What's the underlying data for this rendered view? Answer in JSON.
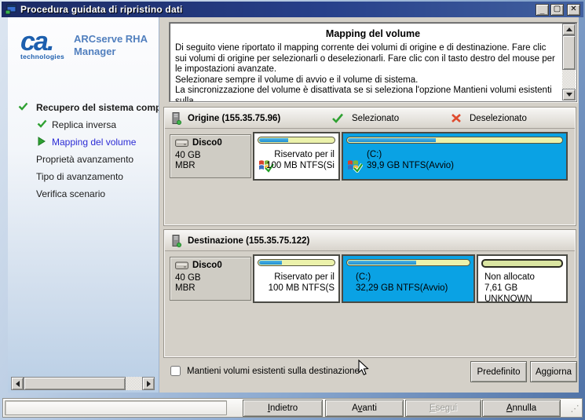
{
  "window": {
    "title": "Procedura guidata di ripristino dati",
    "minimize": "_",
    "maximize": "▢",
    "close": "✕"
  },
  "colors": {
    "titlebar": "#1B2A64",
    "selected_volume": "#0AA2E4",
    "bar_used": "#1F8FD0",
    "bar_free": "#ECF2AB",
    "step_current_text": "#2B2BD5",
    "check_green": "#2FA132",
    "cross_red": "#DF4B2E"
  },
  "sidebar": {
    "brand": "ca.",
    "brand_sub": "technologies",
    "product_line1": "ARCserve RHA",
    "product_line2": "Manager",
    "steps": [
      {
        "label": "Recupero del sistema completo",
        "state": "done"
      },
      {
        "label": "Replica inversa",
        "state": "done"
      },
      {
        "label": "Mapping del volume",
        "state": "current"
      },
      {
        "label": "Proprietà avanzamento",
        "state": "pending"
      },
      {
        "label": "Tipo di avanzamento",
        "state": "pending"
      },
      {
        "label": "Verifica scenario",
        "state": "pending"
      }
    ]
  },
  "description": {
    "title": "Mapping del volume",
    "body": "Di seguito viene riportato il mapping corrente dei volumi di origine e di destinazione. Fare clic sui volumi di origine per selezionarli o deselezionarli. Fare clic con il tasto destro del mouse per le impostazioni avanzate.\nSelezionare sempre il volume di avvio e il volume di sistema.\nLa sincronizzazione del volume è disattivata se si seleziona l'opzione Mantieni volumi esistenti sulla"
  },
  "origin": {
    "title": "Origine (155.35.75.96)",
    "legend_selected": "Selezionato",
    "legend_deselected": "Deselezionato",
    "disk": {
      "name": "Disco0",
      "size": "40 GB",
      "partition": "MBR"
    },
    "volumes": [
      {
        "line1": "Riservato per il",
        "line2": "100 MB NTFS(Si",
        "used_pct": 38,
        "selected": false
      },
      {
        "line1": "(C:)",
        "line2": "39,9 GB NTFS(Avvio)",
        "used_pct": 41,
        "selected": true
      }
    ]
  },
  "destination": {
    "title": "Destinazione (155.35.75.122)",
    "disk": {
      "name": "Disco0",
      "size": "40 GB",
      "partition": "MBR"
    },
    "volumes": [
      {
        "line1": "Riservato per il",
        "line2": "100 MB NTFS(S",
        "used_pct": 30,
        "selected": false
      },
      {
        "line1": "(C:)",
        "line2": "32,29 GB NTFS(Avvio)",
        "used_pct": 56,
        "selected": true
      },
      {
        "line1": "Non allocato",
        "line2": "7,61 GB UNKNOWN",
        "used_pct": 0,
        "selected": false,
        "unallocated": true
      }
    ]
  },
  "options": {
    "keep_volumes_label": "Mantieni volumi esistenti sulla destinazione",
    "keep_volumes_checked": false,
    "default_button": "Predefinito",
    "refresh_button": "Aggiorna"
  },
  "nav": {
    "buttons": [
      {
        "pre": "",
        "key": "I",
        "post": "ndietro",
        "enabled": true
      },
      {
        "pre": "A",
        "key": "v",
        "post": "anti",
        "enabled": true
      },
      {
        "pre": "",
        "key": "E",
        "post": "segui",
        "enabled": false
      },
      {
        "pre": "",
        "key": "A",
        "post": "nnulla",
        "enabled": true
      }
    ]
  }
}
